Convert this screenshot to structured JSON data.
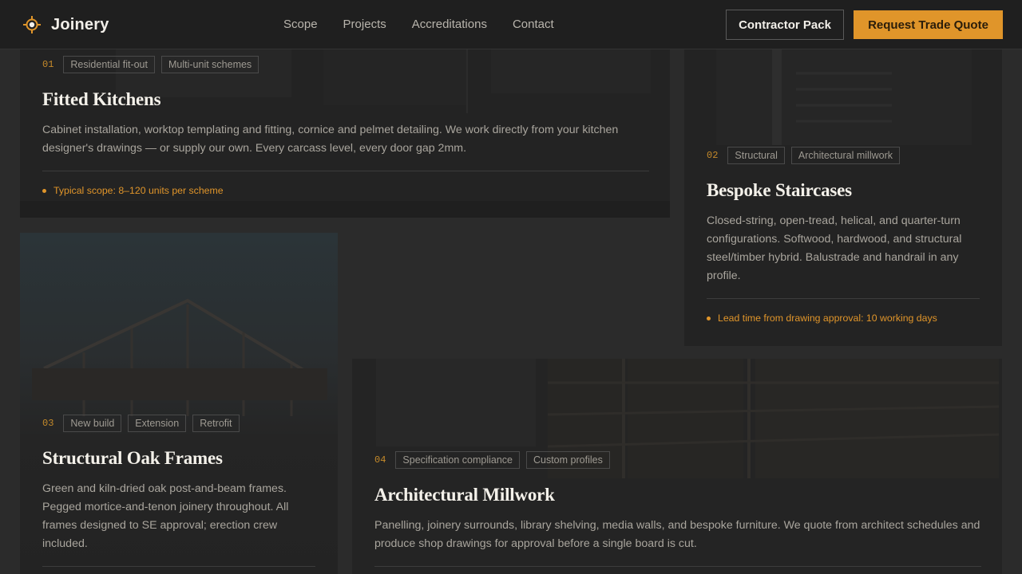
{
  "header": {
    "brand": "Joinery",
    "nav": [
      "Scope",
      "Projects",
      "Accreditations",
      "Contact"
    ],
    "secondary_cta": "Contractor Pack",
    "primary_cta": "Request Trade Quote",
    "accent_color": "#e0952a"
  },
  "cards": [
    {
      "number": "01",
      "tags": [
        "Residential fit-out",
        "Multi-unit schemes"
      ],
      "title": "Fitted Kitchens",
      "description": "Cabinet installation, worktop templating and fitting, cornice and pelmet detailing. We work directly from your kitchen designer's drawings — or supply our own. Every carcass level, every door gap 2mm.",
      "note": "Typical scope: 8–120 units per scheme"
    },
    {
      "number": "02",
      "tags": [
        "Structural",
        "Architectural millwork"
      ],
      "title": "Bespoke Staircases",
      "description": "Closed-string, open-tread, helical, and quarter-turn configurations. Softwood, hardwood, and structural steel/timber hybrid. Balustrade and handrail in any profile.",
      "note": "Lead time from drawing approval: 10 working days"
    },
    {
      "number": "03",
      "tags": [
        "New build",
        "Extension",
        "Retrofit"
      ],
      "title": "Structural Oak Frames",
      "description": "Green and kiln-dried oak post-and-beam frames. Pegged mortice-and-tenon joinery throughout. All frames designed to SE approval; erection crew included."
    },
    {
      "number": "04",
      "tags": [
        "Specification compliance",
        "Custom profiles"
      ],
      "title": "Architectural Millwork",
      "description": "Panelling, joinery surrounds, library shelving, media walls, and bespoke furniture. We quote from architect schedules and produce shop drawings for approval before a single board is cut."
    }
  ]
}
